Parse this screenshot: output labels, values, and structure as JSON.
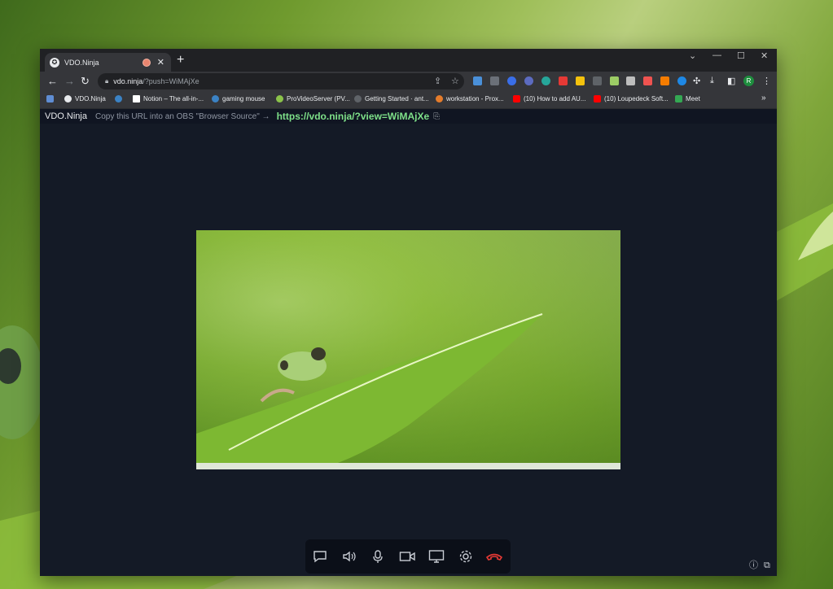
{
  "browser": {
    "tab_title": "VDO.Ninja",
    "address_host": "vdo.ninja",
    "address_path": "/?push=WiMAjXe",
    "bookmarks": [
      {
        "label": "VDO.Ninja",
        "color": "#e8eaed"
      },
      {
        "label": "Notion – The all-in-...",
        "color": "#ffffff"
      },
      {
        "label": "gaming mouse",
        "color": "#3b82c4"
      },
      {
        "label": "ProVideoServer (PV...",
        "color": "#8bc34a"
      },
      {
        "label": "Getting Started · ant...",
        "color": "#5f6368"
      },
      {
        "label": "workstation - Prox...",
        "color": "#e57c2b"
      },
      {
        "label": "(10) How to add AU...",
        "color": "#ff0000"
      },
      {
        "label": "(10) Loupedeck Soft...",
        "color": "#ff0000"
      },
      {
        "label": "Meet",
        "color": "#34a853"
      }
    ],
    "bookmarks_more": "»",
    "profile_initial": "R"
  },
  "app": {
    "brand": "VDO.Ninja",
    "hint": "Copy this URL into an OBS \"Browser Source\" →",
    "view_url": "https://vdo.ninja/?view=WiMAjXe"
  },
  "icons": {
    "controls": [
      "chat-icon",
      "speaker-icon",
      "microphone-icon",
      "camera-icon",
      "screen-share-icon",
      "settings-icon",
      "hangup-icon"
    ]
  },
  "colors": {
    "accent_url": "#7ee089",
    "hangup": "#e53935",
    "page_bg": "#141a26"
  }
}
